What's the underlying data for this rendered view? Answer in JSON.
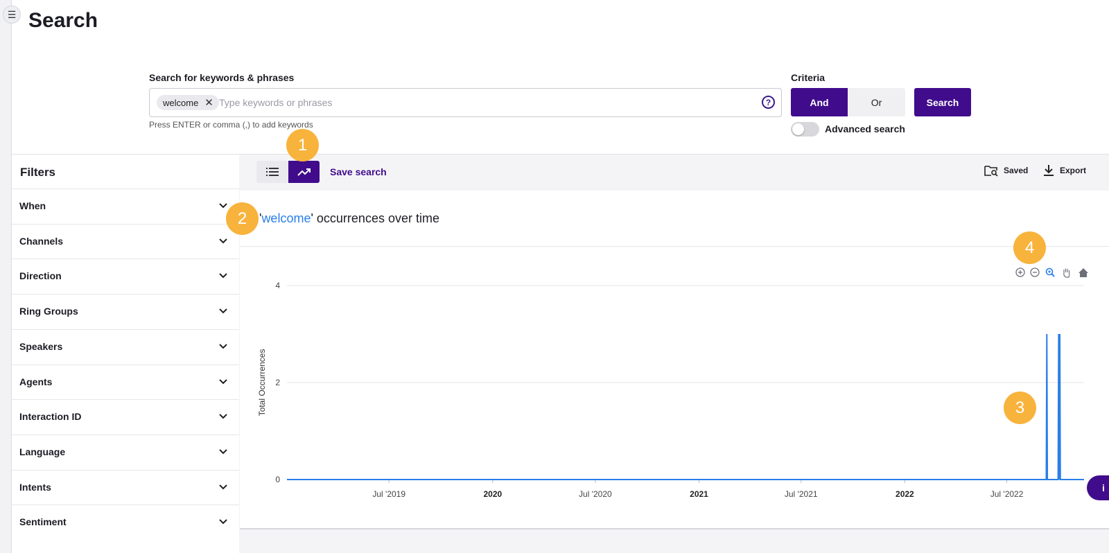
{
  "page": {
    "title": "Search"
  },
  "search": {
    "label": "Search for keywords & phrases",
    "chips": [
      {
        "text": "welcome"
      }
    ],
    "placeholder": "Type keywords or phrases",
    "hint": "Press ENTER or comma (,) to add keywords",
    "help_icon": "?"
  },
  "criteria": {
    "label": "Criteria",
    "and_label": "And",
    "or_label": "Or",
    "selected": "And"
  },
  "search_button": {
    "label": "Search"
  },
  "advanced": {
    "label": "Advanced search",
    "enabled": false
  },
  "filters": {
    "title": "Filters",
    "items": [
      {
        "label": "When"
      },
      {
        "label": "Channels"
      },
      {
        "label": "Direction"
      },
      {
        "label": "Ring Groups"
      },
      {
        "label": "Speakers"
      },
      {
        "label": "Agents"
      },
      {
        "label": "Interaction ID"
      },
      {
        "label": "Language"
      },
      {
        "label": "Intents"
      },
      {
        "label": "Sentiment"
      }
    ]
  },
  "toolbar": {
    "save_search": "Save search",
    "saved": "Saved",
    "export": "Export",
    "active_view": "chart"
  },
  "chart_header": {
    "quote_open": "'",
    "keyword": "welcome",
    "suffix": "' occurrences over time"
  },
  "badges": [
    "1",
    "2",
    "3",
    "4"
  ],
  "info_fab": {
    "label": "i"
  },
  "colors": {
    "accent": "#400c8c",
    "series": "#2a7ee8",
    "badge": "#f8b33c",
    "keyword": "#2a7ee8"
  },
  "chart_data": {
    "type": "line",
    "title": "'welcome' occurrences over time",
    "xlabel": "",
    "ylabel": "Total Occurrences",
    "ylim": [
      0,
      4
    ],
    "yticks": [
      "0",
      "2",
      "4"
    ],
    "xlim": [
      "2019-01-01",
      "2022-11-15"
    ],
    "xticks": [
      {
        "date": "2019-07-01",
        "label": "Jul '2019",
        "bold": false
      },
      {
        "date": "2020-01-01",
        "label": "2020",
        "bold": true
      },
      {
        "date": "2020-07-01",
        "label": "Jul '2020",
        "bold": false
      },
      {
        "date": "2021-01-01",
        "label": "2021",
        "bold": true
      },
      {
        "date": "2021-07-01",
        "label": "Jul '2021",
        "bold": false
      },
      {
        "date": "2022-01-01",
        "label": "2022",
        "bold": true
      },
      {
        "date": "2022-07-01",
        "label": "Jul '2022",
        "bold": false
      }
    ],
    "grid": true,
    "series": [
      {
        "points": [
          {
            "x": "2019-01-01",
            "y": 0
          },
          {
            "x": "2022-09-09",
            "y": 0
          },
          {
            "x": "2022-09-10",
            "y": 3
          },
          {
            "x": "2022-09-11",
            "y": 0
          },
          {
            "x": "2022-09-30",
            "y": 0
          },
          {
            "x": "2022-10-01",
            "y": 3
          },
          {
            "x": "2022-10-02",
            "y": 0
          },
          {
            "x": "2022-10-03",
            "y": 3
          },
          {
            "x": "2022-10-04",
            "y": 0
          },
          {
            "x": "2022-11-15",
            "y": 0
          }
        ]
      }
    ],
    "toolbar_icons": [
      "zoom-in-icon",
      "zoom-out-icon",
      "zoom-select-icon",
      "pan-icon",
      "home-icon"
    ]
  }
}
